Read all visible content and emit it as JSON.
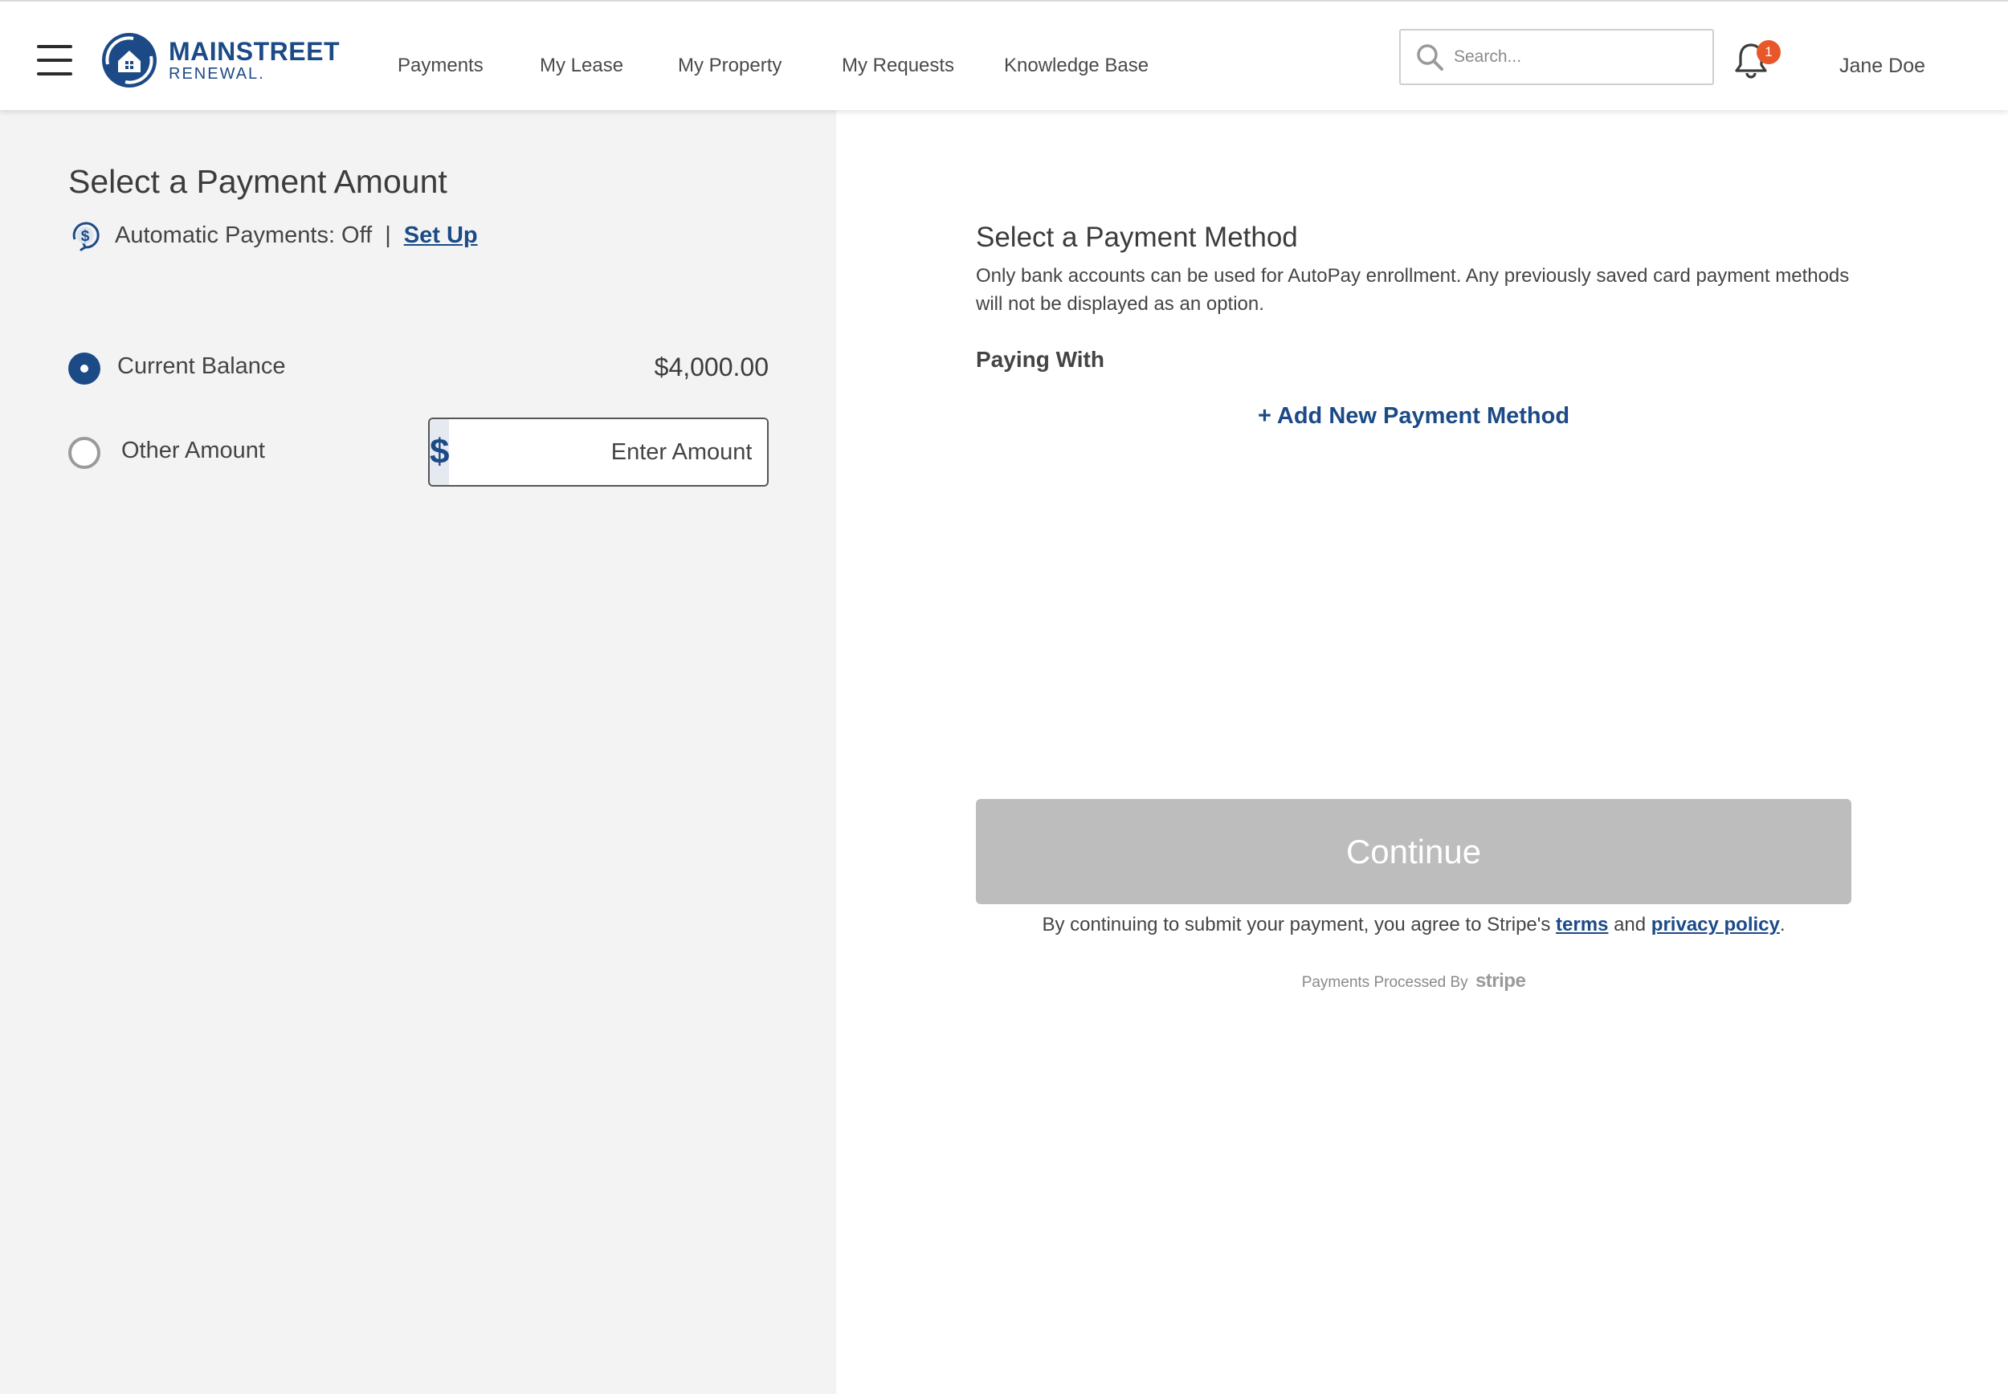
{
  "header": {
    "logo": {
      "main": "MAINSTREET",
      "sub": "RENEWAL."
    },
    "nav": [
      {
        "label": "Payments"
      },
      {
        "label": "My Lease"
      },
      {
        "label": "My Property"
      },
      {
        "label": "My Requests"
      },
      {
        "label": "Knowledge Base"
      }
    ],
    "search": {
      "placeholder": "Search..."
    },
    "notifications": {
      "count": "1"
    },
    "user": {
      "name": "Jane Doe"
    }
  },
  "amount_panel": {
    "title": "Select a Payment Amount",
    "autopay_status": "Automatic Payments: Off",
    "separator": "|",
    "setup_link": "Set Up",
    "current_balance": {
      "label": "Current Balance",
      "value": "$4,000.00",
      "selected": true
    },
    "other_amount": {
      "label": "Other Amount",
      "currency_symbol": "$",
      "placeholder": "Enter Amount",
      "selected": false
    }
  },
  "method_panel": {
    "title": "Select a Payment Method",
    "description": "Only bank accounts can be used for AutoPay enrollment. Any previously saved card payment methods will not be displayed as an option.",
    "paying_with": "Paying With",
    "add_method": "+ Add New Payment Method",
    "continue_label": "Continue",
    "agreement": {
      "prefix": "By continuing to submit your payment, you agree to Stripe's",
      "terms": "terms",
      "and": "and",
      "privacy": "privacy policy",
      "suffix": "."
    },
    "processed_by": "Payments Processed By",
    "processor": "stripe"
  },
  "colors": {
    "brand": "#1b4a87",
    "badge": "#e8572a",
    "disabled_button": "#bdbdbe",
    "left_panel_bg": "#f3f3f3"
  },
  "icons": [
    "hamburger-menu-icon",
    "house-logo-icon",
    "search-icon",
    "bell-icon",
    "autopay-dollar-icon"
  ]
}
